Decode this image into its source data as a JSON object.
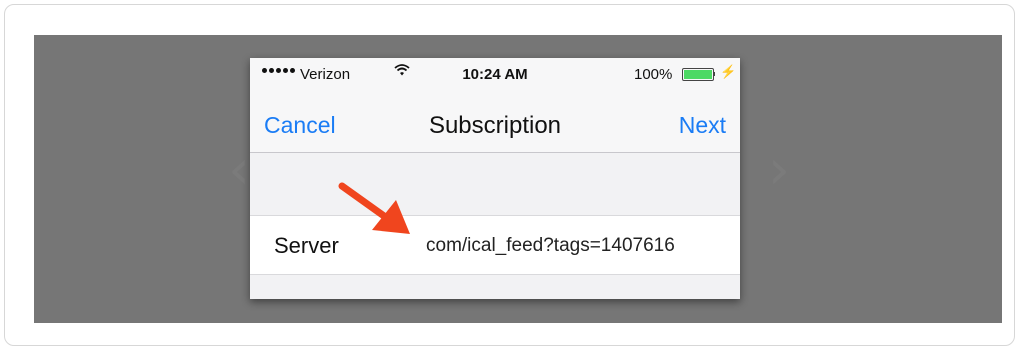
{
  "status_bar": {
    "carrier": "Verizon",
    "time": "10:24 AM",
    "battery_percent": "100%"
  },
  "nav": {
    "cancel_label": "Cancel",
    "title": "Subscription",
    "next_label": "Next"
  },
  "form": {
    "server_label": "Server",
    "server_value": "com/ical_feed?tags=1407616"
  },
  "colors": {
    "accent": "#1a7cf5",
    "annotation_arrow": "#f0451e",
    "backdrop": "#767676"
  },
  "icons": [
    "signal-dots-icon",
    "wifi-icon",
    "battery-icon",
    "charging-bolt-icon",
    "annotation-arrow-icon"
  ]
}
